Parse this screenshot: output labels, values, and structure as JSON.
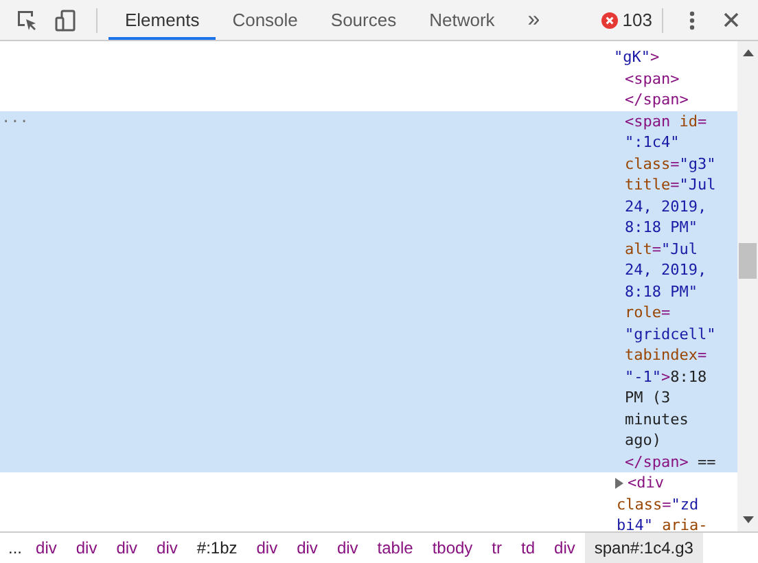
{
  "toolbar": {
    "tabs": [
      {
        "label": "Elements",
        "selected": true
      },
      {
        "label": "Console",
        "selected": false
      },
      {
        "label": "Sources",
        "selected": false
      },
      {
        "label": "Network",
        "selected": false
      }
    ],
    "overflow": "»",
    "error_count": "103"
  },
  "dom_tree": {
    "lines": [
      [
        {
          "kind": "value",
          "text": "\"gK\""
        },
        {
          "kind": "tag",
          "text": ">"
        }
      ]
    ],
    "children": [
      {
        "selected": false,
        "kind": "leaf",
        "lines": [
          [
            {
              "kind": "tag",
              "text": "<span>"
            }
          ],
          [
            {
              "kind": "tag",
              "text": "</span>"
            }
          ]
        ]
      },
      {
        "selected": true,
        "kind": "leaf",
        "ellipsis": "...",
        "lines": [
          [
            {
              "kind": "tag",
              "text": "<span "
            },
            {
              "kind": "attr",
              "text": "id"
            },
            {
              "kind": "tag",
              "text": "="
            }
          ],
          [
            {
              "kind": "value",
              "text": "\":1c4\""
            }
          ],
          [
            {
              "kind": "attr",
              "text": "class"
            },
            {
              "kind": "tag",
              "text": "="
            },
            {
              "kind": "value",
              "text": "\"g3\""
            }
          ],
          [
            {
              "kind": "attr",
              "text": "title"
            },
            {
              "kind": "tag",
              "text": "="
            },
            {
              "kind": "value",
              "text": "\"Jul"
            }
          ],
          [
            {
              "kind": "value",
              "text": "24, 2019,"
            }
          ],
          [
            {
              "kind": "value",
              "text": "8:18 PM\""
            }
          ],
          [
            {
              "kind": "attr",
              "text": "alt"
            },
            {
              "kind": "tag",
              "text": "="
            },
            {
              "kind": "value",
              "text": "\"Jul"
            }
          ],
          [
            {
              "kind": "value",
              "text": "24, 2019,"
            }
          ],
          [
            {
              "kind": "value",
              "text": "8:18 PM\""
            }
          ],
          [
            {
              "kind": "attr",
              "text": "role"
            },
            {
              "kind": "tag",
              "text": "="
            }
          ],
          [
            {
              "kind": "value",
              "text": "\"gridcell\""
            }
          ],
          [
            {
              "kind": "attr",
              "text": "tabindex"
            },
            {
              "kind": "tag",
              "text": "="
            }
          ],
          [
            {
              "kind": "value",
              "text": "\"-1\""
            },
            {
              "kind": "tag",
              "text": ">"
            },
            {
              "kind": "text",
              "text": "8:18"
            }
          ],
          [
            {
              "kind": "text",
              "text": "PM (3"
            }
          ],
          [
            {
              "kind": "text",
              "text": "minutes"
            }
          ],
          [
            {
              "kind": "text",
              "text": "ago)"
            }
          ],
          [
            {
              "kind": "tag",
              "text": "</span>"
            },
            {
              "kind": "text",
              "text": " =="
            }
          ]
        ]
      },
      {
        "selected": false,
        "kind": "collapsible",
        "expanded": false,
        "lines": [
          [
            {
              "kind": "tag",
              "text": "<div"
            }
          ],
          [
            {
              "kind": "attr",
              "text": "class"
            },
            {
              "kind": "tag",
              "text": "="
            },
            {
              "kind": "value",
              "text": "\"zd"
            }
          ],
          [
            {
              "kind": "value",
              "text": "bi4\""
            },
            {
              "kind": "attr",
              "text": " aria-"
            }
          ]
        ]
      }
    ]
  },
  "breadcrumbs": {
    "ellipsis": "...",
    "items": [
      {
        "text": "div",
        "kind": "tag",
        "selected": false
      },
      {
        "text": "div",
        "kind": "tag",
        "selected": false
      },
      {
        "text": "div",
        "kind": "tag",
        "selected": false
      },
      {
        "text": "div",
        "kind": "tag",
        "selected": false
      },
      {
        "text": "#:1bz",
        "kind": "id",
        "selected": false
      },
      {
        "text": "div",
        "kind": "tag",
        "selected": false
      },
      {
        "text": "div",
        "kind": "tag",
        "selected": false
      },
      {
        "text": "div",
        "kind": "tag",
        "selected": false
      },
      {
        "text": "table",
        "kind": "tag",
        "selected": false
      },
      {
        "text": "tbody",
        "kind": "tag",
        "selected": false
      },
      {
        "text": "tr",
        "kind": "tag",
        "selected": false
      },
      {
        "text": "td",
        "kind": "tag",
        "selected": false
      },
      {
        "text": "div",
        "kind": "tag",
        "selected": false
      },
      {
        "text": "span#:1c4.g3",
        "kind": "id",
        "selected": true
      }
    ]
  }
}
